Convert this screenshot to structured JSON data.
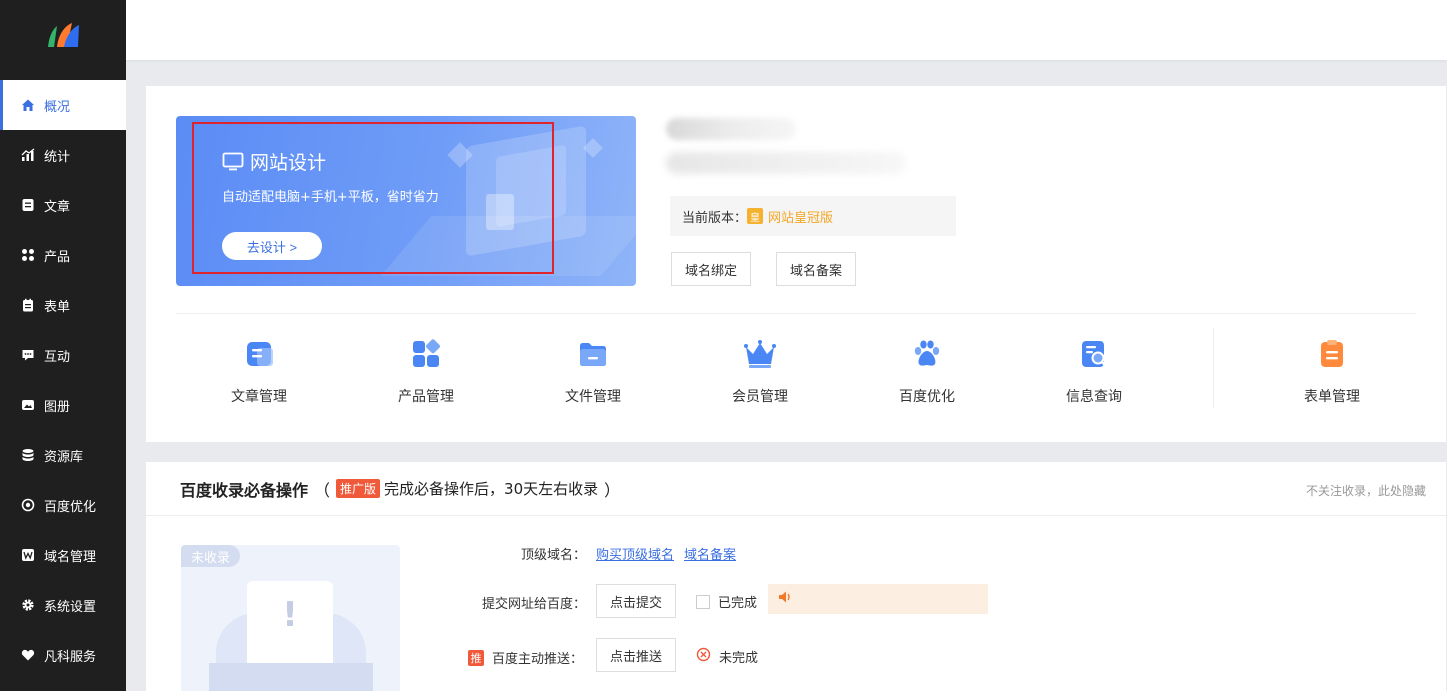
{
  "sidebar": {
    "items": [
      {
        "label": "概况",
        "icon": "home-icon",
        "active": true
      },
      {
        "label": "统计",
        "icon": "stats-icon"
      },
      {
        "label": "文章",
        "icon": "article-icon"
      },
      {
        "label": "产品",
        "icon": "product-icon"
      },
      {
        "label": "表单",
        "icon": "form-icon"
      },
      {
        "label": "互动",
        "icon": "chat-icon"
      },
      {
        "label": "图册",
        "icon": "album-icon"
      },
      {
        "label": "资源库",
        "icon": "database-icon"
      },
      {
        "label": "百度优化",
        "icon": "seo-icon"
      },
      {
        "label": "域名管理",
        "icon": "domain-icon"
      },
      {
        "label": "系统设置",
        "icon": "gear-icon"
      },
      {
        "label": "凡科服务",
        "icon": "heart-icon"
      }
    ]
  },
  "banner": {
    "title": "网站设计",
    "subtitle": "自动适配电脑+手机+平板，省时省力",
    "button": "去设计 >"
  },
  "site": {
    "version_label": "当前版本：",
    "version_badge": "皇",
    "version_name": "网站皇冠版",
    "bind_button": "域名绑定",
    "icp_button": "域名备案"
  },
  "tools": [
    {
      "label": "文章管理",
      "icon": "article-manage-icon"
    },
    {
      "label": "产品管理",
      "icon": "product-manage-icon"
    },
    {
      "label": "文件管理",
      "icon": "file-manage-icon"
    },
    {
      "label": "会员管理",
      "icon": "member-crown-icon"
    },
    {
      "label": "百度优化",
      "icon": "baidu-paw-icon"
    },
    {
      "label": "信息查询",
      "icon": "info-search-icon"
    },
    {
      "label": "表单管理",
      "icon": "form-manage-icon"
    }
  ],
  "seo": {
    "title": "百度收录必备操作",
    "paren_open": "（",
    "tag": "推广版",
    "note": "完成必备操作后，30天左右收录",
    "paren_close": "）",
    "hide_link": "不关注收录，此处隐藏",
    "status_tag": "未收录",
    "row1_label": "顶级域名：",
    "row1_link1": "购买顶级域名",
    "row1_link2": "域名备案",
    "row2_label": "提交网址给百度：",
    "row2_button": "点击提交",
    "row2_status": "已完成",
    "row3_badge": "推",
    "row3_label": "百度主动推送：",
    "row3_button": "点击推送",
    "row3_status": "未完成"
  },
  "colors": {
    "accent": "#3b6fe0",
    "sidebar_bg": "#1f1f1f",
    "highlight_border": "#e0242e",
    "crown_gold": "#f4a623",
    "promo_red": "#f05a3a"
  }
}
